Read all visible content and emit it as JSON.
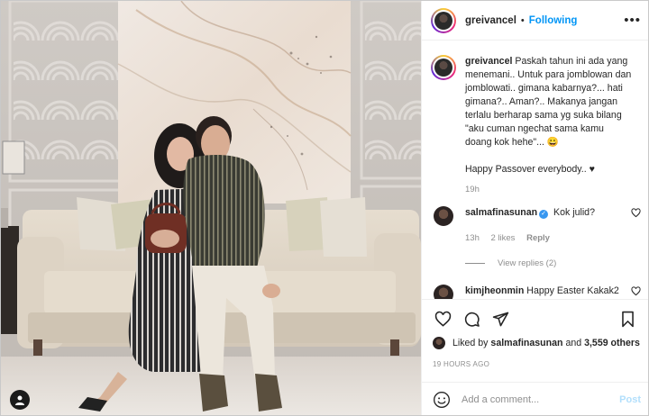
{
  "post": {
    "username": "greivancel",
    "separator": "•",
    "follow_status": "Following",
    "more_label": "•••"
  },
  "caption": {
    "username": "greivancel",
    "text": "Paskah tahun ini ada yang menemani.. Untuk para jomblowan dan jomblowati.. gimana kabarnya?... hati gimana?.. Aman?.. Makanya jangan terlalu berharap sama yg suka bilang \"aku cuman ngechat sama kamu doang kok hehe\"... 😀",
    "extra": "Happy Passover everybody.. ♥",
    "age": "19h"
  },
  "comments": [
    {
      "username": "salmafinasunan",
      "verified": "✓",
      "text": "Kok julid?",
      "age": "13h",
      "likes": "2 likes",
      "reply": "Reply",
      "view_replies": "View replies (2)"
    },
    {
      "username": "kimjheonmin",
      "text": "Happy Easter Kakak2"
    }
  ],
  "likes": {
    "prefix": "Liked by",
    "user": "salmafinasunan",
    "and": "and",
    "others": "3,559 others"
  },
  "timestamp": "19 HOURS AGO",
  "add_comment": {
    "placeholder": "Add a comment...",
    "post_label": "Post"
  },
  "colors": {
    "accent": "#0095f6",
    "post_disabled": "#b2dffc",
    "muted": "#8e8e8e",
    "text": "#262626"
  },
  "icons": [
    "heart-icon",
    "comment-icon",
    "share-icon",
    "bookmark-icon",
    "emoji-icon",
    "user-tag-icon"
  ]
}
